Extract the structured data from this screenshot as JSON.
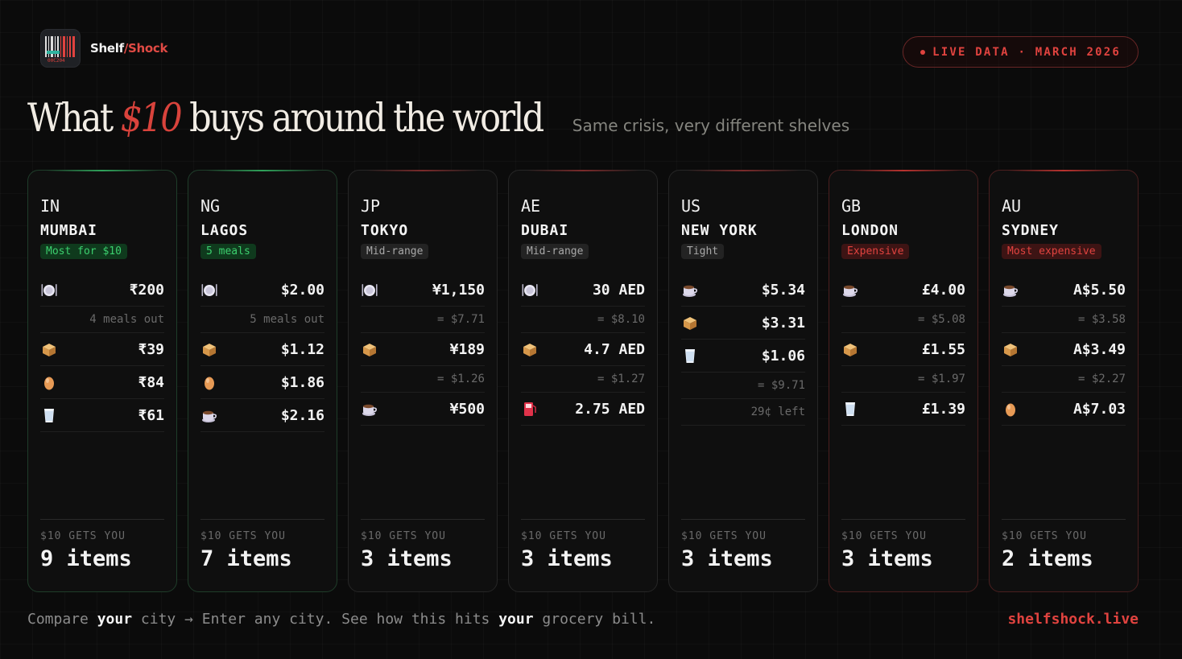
{
  "brand": {
    "part1": "Shelf",
    "slash": "/",
    "part2": "Shock",
    "logo_code": "00C204"
  },
  "badge": {
    "text": "LIVE DATA · MARCH 2026"
  },
  "headline": {
    "pre": "What ",
    "money": "$10",
    "post": " buys around the world",
    "subtitle": "Same crisis, very different shelves"
  },
  "cards": [
    {
      "code": "IN",
      "city": "MUMBAI",
      "tag": "Most for $10",
      "tier": "best",
      "gets": "$10 GETS YOU",
      "count": "9 items",
      "rows": [
        {
          "icon": "meal-icon",
          "price": "₹200"
        },
        {
          "note": "4 meals out"
        },
        {
          "icon": "bread-icon",
          "price": "₹39"
        },
        {
          "icon": "egg-icon",
          "price": "₹84"
        },
        {
          "icon": "milk-icon",
          "price": "₹61"
        }
      ]
    },
    {
      "code": "NG",
      "city": "LAGOS",
      "tag": "5 meals",
      "tier": "best",
      "gets": "$10 GETS YOU",
      "count": "7 items",
      "rows": [
        {
          "icon": "meal-icon",
          "price": "$2.00"
        },
        {
          "note": "5 meals out"
        },
        {
          "icon": "bread-icon",
          "price": "$1.12"
        },
        {
          "icon": "egg-icon",
          "price": "$1.86"
        },
        {
          "icon": "coffee-icon",
          "price": "$2.16"
        }
      ]
    },
    {
      "code": "JP",
      "city": "TOKYO",
      "tag": "Mid-range",
      "tier": "mid",
      "gets": "$10 GETS YOU",
      "count": "3 items",
      "rows": [
        {
          "icon": "meal-icon",
          "price": "¥1,150"
        },
        {
          "note": "= $7.71"
        },
        {
          "icon": "bread-icon",
          "price": "¥189"
        },
        {
          "note": "= $1.26"
        },
        {
          "icon": "coffee-icon",
          "price": "¥500"
        }
      ]
    },
    {
      "code": "AE",
      "city": "DUBAI",
      "tag": "Mid-range",
      "tier": "mid",
      "gets": "$10 GETS YOU",
      "count": "3 items",
      "rows": [
        {
          "icon": "meal-icon",
          "price": "30 AED"
        },
        {
          "note": "= $8.10"
        },
        {
          "icon": "bread-icon",
          "price": "4.7 AED"
        },
        {
          "note": "= $1.27"
        },
        {
          "icon": "fuel-icon",
          "price": "2.75 AED"
        }
      ]
    },
    {
      "code": "US",
      "city": "NEW YORK",
      "tag": "Tight",
      "tier": "mid",
      "gets": "$10 GETS YOU",
      "count": "3 items",
      "rows": [
        {
          "icon": "coffee-icon",
          "price": "$5.34"
        },
        {
          "icon": "bread-icon",
          "price": "$3.31"
        },
        {
          "icon": "milk-icon",
          "price": "$1.06"
        },
        {
          "note": "= $9.71"
        },
        {
          "note": "29¢ left"
        }
      ]
    },
    {
      "code": "GB",
      "city": "LONDON",
      "tag": "Expensive",
      "tier": "exp",
      "gets": "$10 GETS YOU",
      "count": "3 items",
      "rows": [
        {
          "icon": "coffee-icon",
          "price": "£4.00"
        },
        {
          "note": "= $5.08"
        },
        {
          "icon": "bread-icon",
          "price": "£1.55"
        },
        {
          "note": "= $1.97"
        },
        {
          "icon": "milk-icon",
          "price": "£1.39"
        }
      ]
    },
    {
      "code": "AU",
      "city": "SYDNEY",
      "tag": "Most expensive",
      "tier": "exp",
      "gets": "$10 GETS YOU",
      "count": "2 items",
      "rows": [
        {
          "icon": "coffee-icon",
          "price": "A$5.50"
        },
        {
          "note": "= $3.58"
        },
        {
          "icon": "bread-icon",
          "price": "A$3.49"
        },
        {
          "note": "= $2.27"
        },
        {
          "icon": "egg-icon",
          "price": "A$7.03"
        }
      ]
    }
  ],
  "footer": {
    "t1": "Compare ",
    "b1": "your",
    "t2": " city → Enter any city. See how this hits ",
    "b2": "your",
    "t3": " grocery bill.",
    "site": "shelfshock.live"
  },
  "colors": {
    "accent": "#e0433f",
    "green": "#3ccf6e",
    "background": "#0b0b0b"
  }
}
